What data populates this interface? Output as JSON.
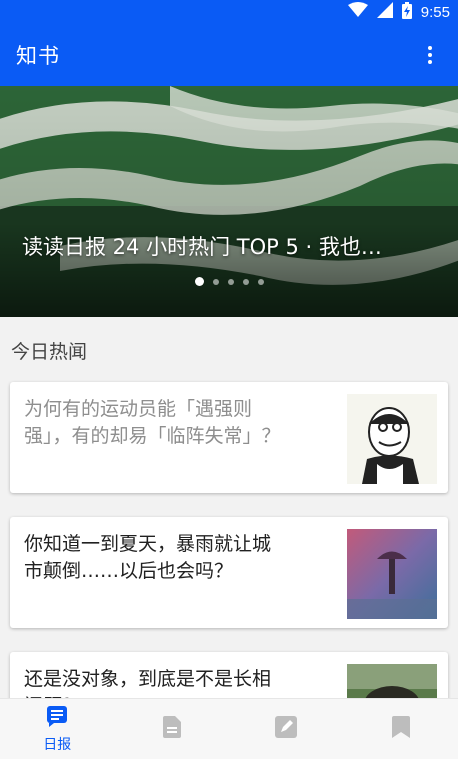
{
  "status_bar": {
    "time": "9:55",
    "icons": [
      "wifi-icon",
      "signal-icon",
      "battery-charging-icon"
    ]
  },
  "app_bar": {
    "title": "知书",
    "menu_icon": "more-vert-icon"
  },
  "banner": {
    "title": "读读日报 24 小时热门 TOP 5 · 我也…",
    "pages": 5,
    "active_page": 1
  },
  "section": {
    "title": "今日热闻"
  },
  "stories": [
    {
      "title": "为何有的运动员能「遇强则强」，有的却易「临阵失常」？",
      "read": true
    },
    {
      "title": "你知道一到夏天，暴雨就让城市颠倒……以后也会吗？",
      "read": false
    },
    {
      "title": "还是没对象，到底是不是长相问题？",
      "read": false
    }
  ],
  "bottom_nav": {
    "items": [
      {
        "icon": "daily-icon",
        "label": "日报",
        "active": true
      },
      {
        "icon": "document-icon",
        "label": "",
        "active": false
      },
      {
        "icon": "edit-icon",
        "label": "",
        "active": false
      },
      {
        "icon": "bookmark-icon",
        "label": "",
        "active": false
      }
    ]
  },
  "colors": {
    "primary": "#0a5bf5",
    "inactive_icon": "#bdbdbd",
    "read_text": "#8e8e8e"
  }
}
